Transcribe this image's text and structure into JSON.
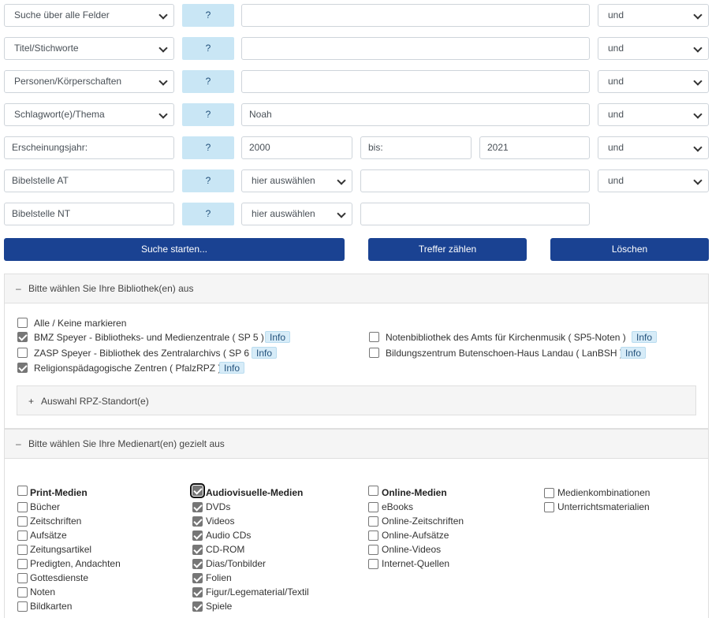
{
  "search_rows": [
    {
      "field": "Suche über alle Felder",
      "help": "?",
      "value": "",
      "operator": "und"
    },
    {
      "field": "Titel/Stichworte",
      "help": "?",
      "value": "",
      "operator": "und"
    },
    {
      "field": "Personen/Körperschaften",
      "help": "?",
      "value": "",
      "operator": "und"
    },
    {
      "field": "Schlagwort(e)/Thema",
      "help": "?",
      "value": "Noah",
      "operator": "und"
    }
  ],
  "year_row": {
    "label": "Erscheinungsjahr:",
    "help": "?",
    "from": "2000",
    "to_label": "bis:",
    "to": "2021",
    "operator": "und"
  },
  "bible_at": {
    "label": "Bibelstelle AT",
    "help": "?",
    "book": "hier auswählen",
    "value": "",
    "operator": "und"
  },
  "bible_nt": {
    "label": "Bibelstelle NT",
    "help": "?",
    "book": "hier auswählen",
    "value": ""
  },
  "buttons": {
    "search": "Suche starten...",
    "count": "Treffer zählen",
    "clear": "Löschen"
  },
  "library_panel": {
    "toggle": "–",
    "title": "Bitte wählen Sie Ihre Bibliothek(en) aus",
    "all_none": "Alle / Keine markieren",
    "libraries": [
      {
        "label": "BMZ Speyer - Bibliotheks- und Medienzentrale ( SP 5 )",
        "info": "Info",
        "checked": true
      },
      {
        "label": "ZASP Speyer - Bibliothek des Zentralarchivs ( SP 6 )",
        "info": "Info",
        "checked": false
      },
      {
        "label": "Religionspädagogische Zentren ( PfalzRPZ )",
        "info": "Info",
        "checked": true
      },
      {
        "label": "Notenbibliothek des Amts für Kirchenmusik ( SP5-Noten )",
        "info": "Info",
        "checked": false
      },
      {
        "label": "Bildungszentrum Butenschoen-Haus Landau ( LanBSH )",
        "info": "Info",
        "checked": false
      }
    ],
    "rpz_toggle": "+",
    "rpz_title": "Auswahl RPZ-Standort(e)"
  },
  "media_panel": {
    "toggle": "–",
    "title": "Bitte wählen Sie Ihre Medienart(en) gezielt aus",
    "columns": [
      {
        "heading": "Print-Medien",
        "checked": false,
        "items": [
          {
            "label": "Bücher",
            "checked": false
          },
          {
            "label": "Zeitschriften",
            "checked": false
          },
          {
            "label": "Aufsätze",
            "checked": false
          },
          {
            "label": "Zeitungsartikel",
            "checked": false
          },
          {
            "label": "Predigten, Andachten",
            "checked": false
          },
          {
            "label": "Gottesdienste",
            "checked": false
          },
          {
            "label": "Noten",
            "checked": false
          },
          {
            "label": "Bildkarten",
            "checked": false
          }
        ]
      },
      {
        "heading": "Audiovisuelle-Medien",
        "checked": true,
        "items": [
          {
            "label": "DVDs",
            "checked": true
          },
          {
            "label": "Videos",
            "checked": true
          },
          {
            "label": "Audio CDs",
            "checked": true
          },
          {
            "label": "CD-ROM",
            "checked": true
          },
          {
            "label": "Dias/Tonbilder",
            "checked": true
          },
          {
            "label": "Folien",
            "checked": true
          },
          {
            "label": "Figur/Legematerial/Textil",
            "checked": true
          },
          {
            "label": "Spiele",
            "checked": true
          }
        ]
      },
      {
        "heading": "Online-Medien",
        "checked": false,
        "items": [
          {
            "label": "eBooks",
            "checked": false
          },
          {
            "label": "Online-Zeitschriften",
            "checked": false
          },
          {
            "label": "Online-Aufsätze",
            "checked": false
          },
          {
            "label": "Online-Videos",
            "checked": false
          },
          {
            "label": "Internet-Quellen",
            "checked": false
          }
        ]
      },
      {
        "heading": "",
        "checked": false,
        "items": [
          {
            "label": "Medienkombinationen",
            "checked": false
          },
          {
            "label": "Unterrichtsmaterialien",
            "checked": false
          }
        ]
      }
    ]
  }
}
